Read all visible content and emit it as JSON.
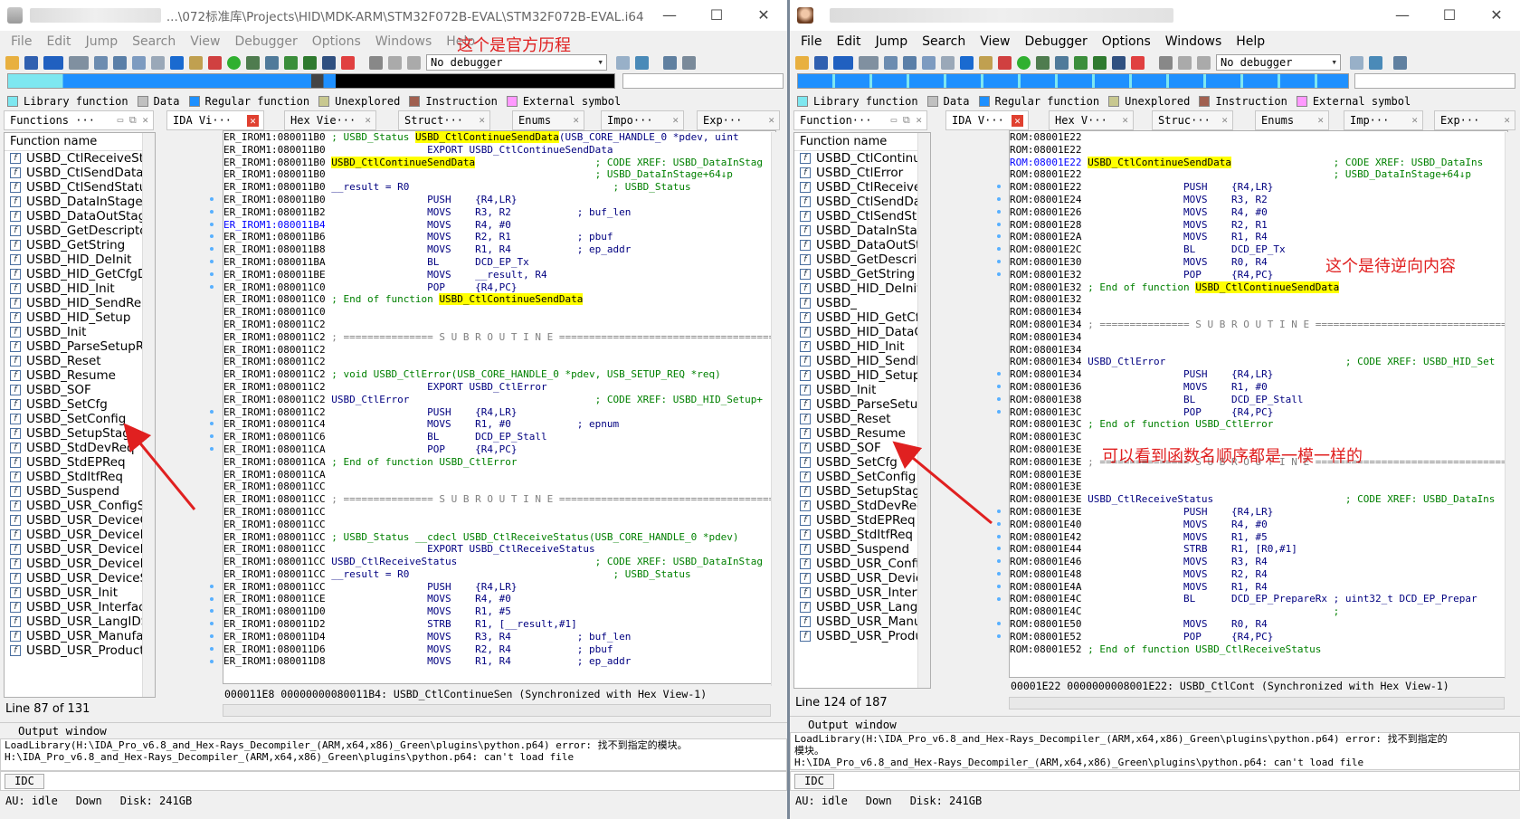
{
  "left": {
    "title": "...\\072标准库\\Projects\\HID\\MDK-ARM\\STM32F072B-EVAL\\STM32F072B-EVAL.i64 (...",
    "menu": [
      "File",
      "Edit",
      "Jump",
      "Search",
      "View",
      "Debugger",
      "Options",
      "Windows",
      "Help"
    ],
    "annotation": "这个是官方历程",
    "debugger": "No debugger",
    "legend": [
      "Library function",
      "Data",
      "Regular function",
      "Unexplored",
      "Instruction",
      "External symbol"
    ],
    "tabs": [
      "Functions ···",
      "IDA Vi···",
      "Hex Vie···",
      "Struct···",
      "Enums",
      "Impo···",
      "Exp···"
    ],
    "func_header": "Function name",
    "functions": [
      "USBD_CtlReceiveSta",
      "USBD_CtlSendData",
      "USBD_CtlSendStatus",
      "USBD_DataInStage",
      "USBD_DataOutStage",
      "USBD_GetDescripto",
      "USBD_GetString",
      "USBD_HID_DeInit",
      "USBD_HID_GetCfgD",
      "USBD_HID_Init",
      "USBD_HID_SendRep",
      "USBD_HID_Setup",
      "USBD_Init",
      "USBD_ParseSetupRe",
      "USBD_Reset",
      "USBD_Resume",
      "USBD_SOF",
      "USBD_SetCfg",
      "USBD_SetConfig",
      "USBD_SetupStage",
      "USBD_StdDevReq",
      "USBD_StdEPReq",
      "USBD_StdItfReq",
      "USBD_Suspend",
      "USBD_USR_ConfigSt",
      "USBD_USR_DeviceC",
      "USBD_USR_DeviceD",
      "USBD_USR_DeviceR",
      "USBD_USR_DeviceR",
      "USBD_USR_DeviceS",
      "USBD_USR_Init",
      "USBD_USR_Interface",
      "USBD_USR_LangIDS",
      "USBD_USR_Manufac",
      "USBD_USR_Product"
    ],
    "line_status": "Line 87 of 131",
    "code": [
      [
        "ER_IROM1:080011B0",
        "",
        "; USBD_Status ",
        "USBD_CtlContinueSendData",
        "(USB_CORE_HANDLE_0 *pdev, uint"
      ],
      [
        "ER_IROM1:080011B0",
        "",
        "",
        "",
        "                EXPORT USBD_CtlContinueSendData"
      ],
      [
        "ER_IROM1:080011B0",
        "",
        "",
        "USBD_CtlContinueSendData",
        "                    ; CODE XREF: USBD_DataInStag"
      ],
      [
        "ER_IROM1:080011B0",
        "",
        "",
        "",
        "                                            ; USBD_DataInStage+64↓p"
      ],
      [
        "ER_IROM1:080011B0",
        "",
        "__result = R0",
        "",
        "                                  ; USBD_Status"
      ],
      [
        "ER_IROM1:080011B0",
        "",
        "",
        "",
        "                PUSH    {R4,LR}"
      ],
      [
        "ER_IROM1:080011B2",
        "",
        "",
        "",
        "                MOVS    R3, R2           ; buf_len"
      ],
      [
        "ER_IROM1:080011B4",
        "b",
        "",
        "",
        "                MOVS    R4, #0"
      ],
      [
        "ER_IROM1:080011B6",
        "",
        "",
        "",
        "                MOVS    R2, R1           ; pbuf"
      ],
      [
        "ER_IROM1:080011B8",
        "",
        "",
        "",
        "                MOVS    R1, R4           ; ep_addr"
      ],
      [
        "ER_IROM1:080011BA",
        "",
        "",
        "",
        "                BL      DCD_EP_Tx"
      ],
      [
        "ER_IROM1:080011BE",
        "",
        "",
        "",
        "                MOVS    __result, R4"
      ],
      [
        "ER_IROM1:080011C0",
        "",
        "",
        "",
        "                POP     {R4,PC}"
      ],
      [
        "ER_IROM1:080011C0",
        "",
        "; End of function ",
        "USBD_CtlContinueSendData",
        ""
      ],
      [
        "ER_IROM1:080011C0",
        "",
        "",
        "",
        ""
      ],
      [
        "ER_IROM1:080011C2",
        "",
        "",
        "",
        ""
      ],
      [
        "ER_IROM1:080011C2",
        "",
        "; =============== S U B R O U T I N E =======================================",
        "",
        ""
      ],
      [
        "ER_IROM1:080011C2",
        "",
        "",
        "",
        ""
      ],
      [
        "ER_IROM1:080011C2",
        "",
        "",
        "",
        ""
      ],
      [
        "ER_IROM1:080011C2",
        "",
        "; void USBD_CtlError(USB_CORE_HANDLE_0 *pdev, USB_SETUP_REQ *req)",
        "",
        ""
      ],
      [
        "ER_IROM1:080011C2",
        "",
        "",
        "",
        "                EXPORT USBD_CtlError"
      ],
      [
        "ER_IROM1:080011C2",
        "",
        "USBD_CtlError",
        "",
        "                               ; CODE XREF: USBD_HID_Setup+"
      ],
      [
        "ER_IROM1:080011C2",
        "",
        "",
        "",
        "                PUSH    {R4,LR}"
      ],
      [
        "ER_IROM1:080011C4",
        "",
        "",
        "",
        "                MOVS    R1, #0           ; epnum"
      ],
      [
        "ER_IROM1:080011C6",
        "",
        "",
        "",
        "                BL      DCD_EP_Stall"
      ],
      [
        "ER_IROM1:080011CA",
        "",
        "",
        "",
        "                POP     {R4,PC}"
      ],
      [
        "ER_IROM1:080011CA",
        "",
        "; End of function USBD_CtlError",
        "",
        ""
      ],
      [
        "ER_IROM1:080011CA",
        "",
        "",
        "",
        ""
      ],
      [
        "ER_IROM1:080011CC",
        "",
        "",
        "",
        ""
      ],
      [
        "ER_IROM1:080011CC",
        "",
        "; =============== S U B R O U T I N E =======================================",
        "",
        ""
      ],
      [
        "ER_IROM1:080011CC",
        "",
        "",
        "",
        ""
      ],
      [
        "ER_IROM1:080011CC",
        "",
        "",
        "",
        ""
      ],
      [
        "ER_IROM1:080011CC",
        "",
        "; USBD_Status __cdecl USBD_CtlReceiveStatus(USB_CORE_HANDLE_0 *pdev)",
        "",
        ""
      ],
      [
        "ER_IROM1:080011CC",
        "",
        "",
        "",
        "                EXPORT USBD_CtlReceiveStatus"
      ],
      [
        "ER_IROM1:080011CC",
        "",
        "USBD_CtlReceiveStatus",
        "",
        "                       ; CODE XREF: USBD_DataInStag"
      ],
      [
        "ER_IROM1:080011CC",
        "",
        "__result = R0",
        "",
        "                                  ; USBD_Status"
      ],
      [
        "ER_IROM1:080011CC",
        "",
        "",
        "",
        "                PUSH    {R4,LR}"
      ],
      [
        "ER_IROM1:080011CE",
        "",
        "",
        "",
        "                MOVS    R4, #0"
      ],
      [
        "ER_IROM1:080011D0",
        "",
        "",
        "",
        "                MOVS    R1, #5"
      ],
      [
        "ER_IROM1:080011D2",
        "",
        "",
        "",
        "                STRB    R1, [__result,#1]"
      ],
      [
        "ER_IROM1:080011D4",
        "",
        "",
        "",
        "                MOVS    R3, R4           ; buf_len"
      ],
      [
        "ER_IROM1:080011D6",
        "",
        "",
        "",
        "                MOVS    R2, R4           ; pbuf"
      ],
      [
        "ER_IROM1:080011D8",
        "",
        "",
        "",
        "                MOVS    R1, R4           ; ep_addr"
      ]
    ],
    "sync": "000011E8 00000000080011B4: USBD_CtlContinueSen (Synchronized with Hex View-1)",
    "output_title": "Output window",
    "output": "LoadLibrary(H:\\IDA_Pro_v6.8_and_Hex-Rays_Decompiler_(ARM,x64,x86)_Green\\plugins\\python.p64) error: 找不到指定的模块。\nH:\\IDA_Pro_v6.8_and_Hex-Rays_Decompiler_(ARM,x64,x86)_Green\\plugins\\python.p64: can't load file",
    "idc": "IDC",
    "status": [
      "AU:  idle",
      "Down",
      "Disk: 241GB"
    ]
  },
  "right": {
    "title": "",
    "menu": [
      "File",
      "Edit",
      "Jump",
      "Search",
      "View",
      "Debugger",
      "Options",
      "Windows",
      "Help"
    ],
    "annotation1": "这个是待逆向内容",
    "annotation2": "可以看到函数名顺序都是一模一样的",
    "debugger": "No debugger",
    "legend": [
      "Library function",
      "Data",
      "Regular function",
      "Unexplored",
      "Instruction",
      "External symbol"
    ],
    "tabs": [
      "Function···",
      "IDA V···",
      "Hex V···",
      "Struc···",
      "Enums",
      "Imp···",
      "Exp···"
    ],
    "func_header": "Function name",
    "functions": [
      "USBD_CtlContinue",
      "USBD_CtlError",
      "USBD_CtlReceiveS",
      "USBD_CtlSendDat",
      "USBD_CtlSendStat",
      "USBD_DataInStage",
      "USBD_DataOutSta",
      "USBD_GetDescript",
      "USBD_GetString",
      "USBD_HID_DeInit",
      "USBD_",
      "USBD_HID_GetCfg",
      "USBD_HID_DataOu",
      "USBD_HID_Init",
      "USBD_HID_SendR",
      "USBD_HID_Setup",
      "USBD_Init",
      "USBD_ParseSetupl",
      "USBD_Reset",
      "USBD_Resume",
      "USBD_SOF",
      "USBD_SetCfg",
      "USBD_SetConfig",
      "USBD_SetupStage",
      "USBD_StdDevReq",
      "USBD_StdEPReq",
      "USBD_StdItfReq",
      "USBD_Suspend",
      "USBD_USR_Config",
      "USBD_USR_Device",
      "USBD_USR_Interfa",
      "USBD_USR_LangID",
      "USBD_USR_Manuf",
      "USBD_USR_Produ"
    ],
    "line_status": "Line 124 of 187",
    "code": [
      [
        "ROM:08001E22",
        "",
        "",
        "",
        ""
      ],
      [
        "ROM:08001E22",
        "",
        "",
        "",
        ""
      ],
      [
        "ROM:08001E22",
        "b",
        "",
        "USBD_CtlContinueSendData",
        "                 ; CODE XREF: USBD_DataIns"
      ],
      [
        "ROM:08001E22",
        "",
        "",
        "",
        "                                         ; USBD_DataInStage+64↓p"
      ],
      [
        "ROM:08001E22",
        "",
        "",
        "",
        "                PUSH    {R4,LR}"
      ],
      [
        "ROM:08001E24",
        "",
        "",
        "",
        "                MOVS    R3, R2"
      ],
      [
        "ROM:08001E26",
        "",
        "",
        "",
        "                MOVS    R4, #0"
      ],
      [
        "ROM:08001E28",
        "",
        "",
        "",
        "                MOVS    R2, R1"
      ],
      [
        "ROM:08001E2A",
        "",
        "",
        "",
        "                MOVS    R1, R4"
      ],
      [
        "ROM:08001E2C",
        "",
        "",
        "",
        "                BL      DCD_EP_Tx"
      ],
      [
        "ROM:08001E30",
        "",
        "",
        "",
        "                MOVS    R0, R4"
      ],
      [
        "ROM:08001E32",
        "",
        "",
        "",
        "                POP     {R4,PC}"
      ],
      [
        "ROM:08001E32",
        "",
        "; End of function ",
        "USBD_CtlContinueSendData",
        ""
      ],
      [
        "ROM:08001E32",
        "",
        "",
        "",
        ""
      ],
      [
        "ROM:08001E34",
        "",
        "",
        "",
        ""
      ],
      [
        "ROM:08001E34",
        "",
        "; =============== S U B R O U T I N E =======================================",
        "",
        ""
      ],
      [
        "ROM:08001E34",
        "",
        "",
        "",
        ""
      ],
      [
        "ROM:08001E34",
        "",
        "",
        "",
        ""
      ],
      [
        "ROM:08001E34",
        "",
        "USBD_CtlError",
        "",
        "                              ; CODE XREF: USBD_HID_Set"
      ],
      [
        "ROM:08001E34",
        "",
        "",
        "",
        "                PUSH    {R4,LR}"
      ],
      [
        "ROM:08001E36",
        "",
        "",
        "",
        "                MOVS    R1, #0"
      ],
      [
        "ROM:08001E38",
        "",
        "",
        "",
        "                BL      DCD_EP_Stall"
      ],
      [
        "ROM:08001E3C",
        "",
        "",
        "",
        "                POP     {R4,PC}"
      ],
      [
        "ROM:08001E3C",
        "",
        "; End of function USBD_CtlError",
        "",
        ""
      ],
      [
        "ROM:08001E3C",
        "",
        "",
        "",
        ""
      ],
      [
        "ROM:08001E3E",
        "",
        "",
        "",
        ""
      ],
      [
        "ROM:08001E3E",
        "",
        "; =============== S U B R O U T I N E =======================================",
        "",
        ""
      ],
      [
        "ROM:08001E3E",
        "",
        "",
        "",
        ""
      ],
      [
        "ROM:08001E3E",
        "",
        "",
        "",
        ""
      ],
      [
        "ROM:08001E3E",
        "",
        "USBD_CtlReceiveStatus",
        "",
        "                      ; CODE XREF: USBD_DataIns"
      ],
      [
        "ROM:08001E3E",
        "",
        "",
        "",
        "                PUSH    {R4,LR}"
      ],
      [
        "ROM:08001E40",
        "",
        "",
        "",
        "                MOVS    R4, #0"
      ],
      [
        "ROM:08001E42",
        "",
        "",
        "",
        "                MOVS    R1, #5"
      ],
      [
        "ROM:08001E44",
        "",
        "",
        "",
        "                STRB    R1, [R0,#1]"
      ],
      [
        "ROM:08001E46",
        "",
        "",
        "",
        "                MOVS    R3, R4"
      ],
      [
        "ROM:08001E48",
        "",
        "",
        "",
        "                MOVS    R2, R4"
      ],
      [
        "ROM:08001E4A",
        "",
        "",
        "",
        "                MOVS    R1, R4"
      ],
      [
        "ROM:08001E4C",
        "",
        "",
        "",
        "                BL      DCD_EP_PrepareRx ; uint32_t DCD_EP_Prepar"
      ],
      [
        "ROM:08001E4C",
        "",
        "",
        "",
        "                                         ;"
      ],
      [
        "ROM:08001E50",
        "",
        "",
        "",
        "                MOVS    R0, R4"
      ],
      [
        "ROM:08001E52",
        "",
        "",
        "",
        "                POP     {R4,PC}"
      ],
      [
        "ROM:08001E52",
        "",
        "; End of function USBD_CtlReceiveStatus",
        "",
        ""
      ]
    ],
    "sync": "00001E22 0000000008001E22: USBD_CtlCont (Synchronized with Hex View-1)",
    "output_title": "Output window",
    "output": "LoadLibrary(H:\\IDA_Pro_v6.8_and_Hex-Rays_Decompiler_(ARM,x64,x86)_Green\\plugins\\python.p64) error: 找不到指定的\n模块。\nH:\\IDA_Pro_v6.8_and_Hex-Rays_Decompiler_(ARM,x64,x86)_Green\\plugins\\python.p64: can't load file",
    "idc": "IDC",
    "status": [
      "AU:  idle",
      "Down",
      "Disk: 241GB"
    ]
  },
  "colors": {
    "library": "#7ee7f0",
    "data": "#c0c0c0",
    "regular": "#1e90ff",
    "unexplored": "#c8c890",
    "instruction": "#a06050",
    "external": "#ff99ff",
    "annotation": "#e02020",
    "highlight": "#ffff00"
  }
}
